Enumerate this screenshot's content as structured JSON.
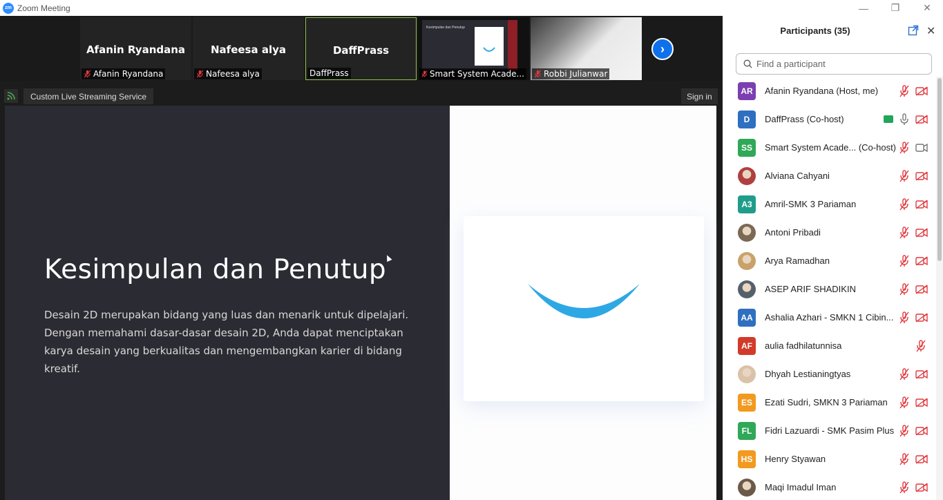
{
  "window": {
    "title": "Zoom Meeting",
    "logo_text": "zm"
  },
  "video_strip": {
    "tiles": [
      {
        "center_name": "Afanin Ryandana",
        "label": "Afanin Ryandana",
        "muted": true
      },
      {
        "center_name": "Nafeesa alya",
        "label": "Nafeesa alya",
        "muted": true
      },
      {
        "center_name": "DaffPrass",
        "label": "DaffPrass",
        "muted": false,
        "active": true
      },
      {
        "center_name": "",
        "label": "Smart System Acade...",
        "muted": true
      },
      {
        "center_name": "",
        "label": "Robbi Julianwar",
        "muted": true
      }
    ],
    "next_icon": "chevron-right-icon",
    "thumb_slide_title": "Kesimpulan dan Penutup"
  },
  "stream_bar": {
    "service_label": "Custom Live Streaming Service",
    "signin_label": "Sign in"
  },
  "slide": {
    "title": "Kesimpulan dan Penutup",
    "body": "Desain 2D merupakan bidang yang luas dan menarik untuk dipelajari. Dengan memahami dasar-dasar desain 2D, Anda dapat menciptakan karya desain yang berkualitas dan mengembangkan karier di bidang kreatif.",
    "accent_color": "#2ea8e4"
  },
  "participants_panel": {
    "title": "Participants (35)",
    "search_placeholder": "Find a participant",
    "participants": [
      {
        "initials": "AR",
        "name": "Afanin Ryandana (Host, me)",
        "color": "#7b3fb0",
        "mic": "off",
        "cam": "off"
      },
      {
        "initials": "D",
        "name": "DaffPrass (Co-host)",
        "color": "#2f6fc0",
        "mic": "on",
        "cam": "off",
        "sharing": true
      },
      {
        "initials": "SS",
        "name": "Smart System Acade...  (Co-host)",
        "color": "#2fa858",
        "mic": "off",
        "cam": "on"
      },
      {
        "initials": "",
        "name": "Alviana Cahyani",
        "color": "#b04040",
        "mic": "off",
        "cam": "off",
        "photo": true
      },
      {
        "initials": "A3",
        "name": "Amril-SMK 3 Pariaman",
        "color": "#1f9d8a",
        "mic": "off",
        "cam": "off"
      },
      {
        "initials": "",
        "name": "Antoni Pribadi",
        "color": "#7a6a55",
        "mic": "off",
        "cam": "off",
        "photo": true
      },
      {
        "initials": "",
        "name": "Arya Ramadhan",
        "color": "#c9a26a",
        "mic": "off",
        "cam": "off",
        "photo": true
      },
      {
        "initials": "",
        "name": "ASEP ARIF SHADIKIN",
        "color": "#55606b",
        "mic": "off",
        "cam": "off",
        "photo": true
      },
      {
        "initials": "AA",
        "name": "Ashalia Azhari - SMKN 1 Cibin...",
        "color": "#2f6fc0",
        "mic": "off",
        "cam": "off"
      },
      {
        "initials": "AF",
        "name": "aulia fadhilatunnisa",
        "color": "#d23a2a",
        "mic": "off",
        "cam": "none"
      },
      {
        "initials": "",
        "name": "Dhyah Lestianingtyas",
        "color": "#d9c2a8",
        "mic": "off",
        "cam": "off",
        "photo": true
      },
      {
        "initials": "ES",
        "name": "Ezati Sudri, SMKN 3 Pariaman",
        "color": "#f29a1f",
        "mic": "off",
        "cam": "off"
      },
      {
        "initials": "FL",
        "name": "Fidri Lazuardi - SMK Pasim Plus",
        "color": "#2fa858",
        "mic": "off",
        "cam": "off"
      },
      {
        "initials": "HS",
        "name": "Henry Styawan",
        "color": "#f29a1f",
        "mic": "off",
        "cam": "off"
      },
      {
        "initials": "",
        "name": "Maqi Imadul Iman",
        "color": "#6b5a4a",
        "mic": "off",
        "cam": "off",
        "photo": true
      }
    ]
  }
}
